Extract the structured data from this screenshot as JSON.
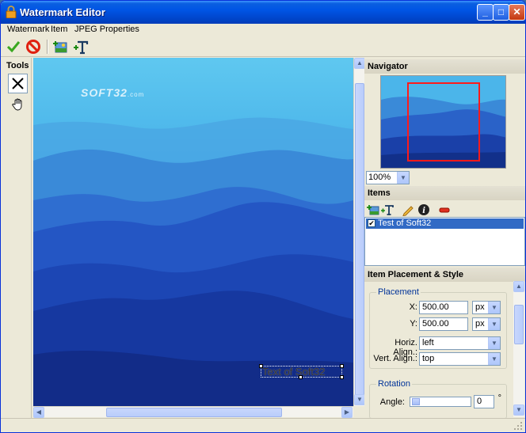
{
  "window": {
    "title": "Watermark Editor"
  },
  "title_buttons": {
    "minimize": "_",
    "maximize": "□",
    "close": "✕"
  },
  "menu": {
    "items": [
      "Watermark",
      "Item",
      "JPEG Properties"
    ]
  },
  "toolbar": {
    "icons": [
      "ok-icon",
      "cancel-icon",
      "add-image-icon",
      "add-text-icon"
    ]
  },
  "tools": {
    "title": "Tools",
    "items": [
      "select-tool",
      "hand-tool"
    ]
  },
  "canvas": {
    "watermark_logo": "SOFT32",
    "watermark_logo_suffix": ".com",
    "text_item": "Text of Soft32"
  },
  "navigator": {
    "title": "Navigator",
    "zoom": "100%"
  },
  "items": {
    "title": "Items",
    "list": [
      {
        "label": "Test of Soft32",
        "checked": true,
        "selected": true
      }
    ]
  },
  "placement": {
    "title": "Item Placement & Style",
    "group_title": "Placement",
    "x_label": "X:",
    "x_value": "500.00",
    "x_unit": "px",
    "y_label": "Y:",
    "y_value": "500.00",
    "y_unit": "px",
    "horiz_label": "Horiz. Align.:",
    "horiz_value": "left",
    "vert_label": "Vert. Align.:",
    "vert_value": "top",
    "rotation_title": "Rotation",
    "angle_label": "Angle:",
    "angle_value": "0",
    "angle_unit": "°"
  },
  "colors": {
    "titlebar": "#0055e5",
    "selection": "#316ac5",
    "nav_rect": "#ff1a1a"
  }
}
